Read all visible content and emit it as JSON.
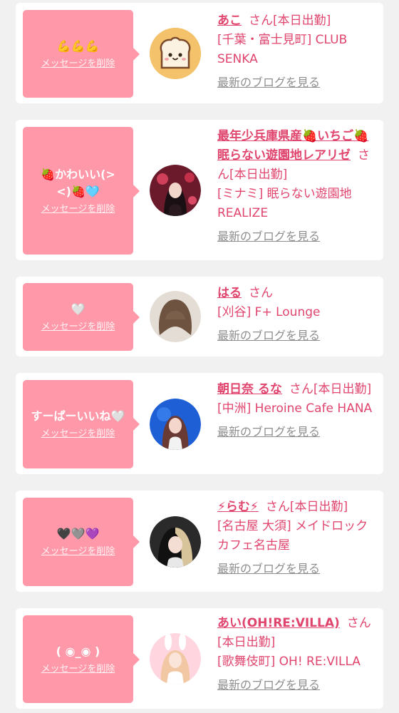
{
  "messages": [
    {
      "message": "💪💪💪",
      "delete_label": "メッセージを削除",
      "name": "あこ",
      "honorific": "さん",
      "status": "[本日出勤]",
      "shop": "[千葉・富士見町] CLUB SENKA",
      "blog_label": "最新のブログを見る",
      "avatar": "toast-icon"
    },
    {
      "message": "🍓かわいい(> <)🍓🩵",
      "delete_label": "メッセージを削除",
      "name": "最年少兵庫県産🍓いちご🍓 眠らない遊園地レアリゼ",
      "honorific": "さん",
      "status": "[本日出勤]",
      "shop": "[ミナミ] 眠らない遊園地 REALIZE",
      "blog_label": "最新のブログを見る",
      "avatar": "profile-photo"
    },
    {
      "message": "🤍",
      "delete_label": "メッセージを削除",
      "name": "はる",
      "honorific": "さん",
      "status": "",
      "shop": "[刈谷] F+ Lounge",
      "blog_label": "最新のブログを見る",
      "avatar": "profile-photo"
    },
    {
      "message": "すーぱーいいね🤍",
      "delete_label": "メッセージを削除",
      "name": "朝日奈 るな",
      "honorific": "さん",
      "status": "[本日出勤]",
      "shop": "[中洲] Heroine Cafe HANA",
      "blog_label": "最新のブログを見る",
      "avatar": "profile-photo"
    },
    {
      "message": "🖤🩶💜",
      "delete_label": "メッセージを削除",
      "name": "⚡らむ⚡",
      "honorific": "さん",
      "status": "[本日出勤]",
      "shop": "[名古屋 大須] メイドロックカフェ名古屋",
      "blog_label": "最新のブログを見る",
      "avatar": "profile-photo"
    },
    {
      "message": "( ◉_◉ )",
      "delete_label": "メッセージを削除",
      "name": "あい(OH!RE:VILLA)",
      "honorific": "さん",
      "status": "[本日出勤]",
      "shop": "[歌舞伎町] OH! RE:VILLA",
      "blog_label": "最新のブログを見る",
      "avatar": "profile-photo"
    }
  ],
  "colors": {
    "bubble": "#ff98a8",
    "accent": "#e0456e",
    "link_gray": "#8e8e8e",
    "background": "#f1f1f1"
  }
}
